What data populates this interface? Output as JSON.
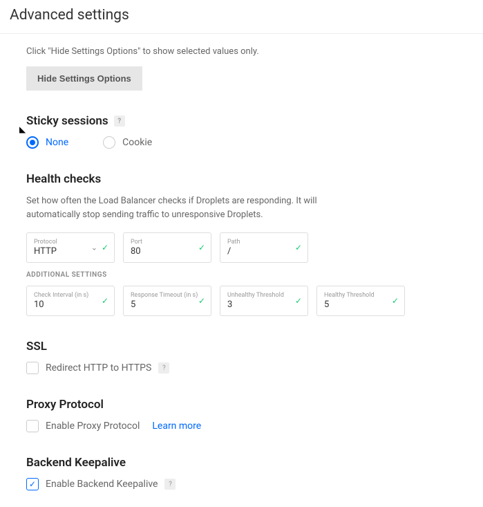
{
  "page_title": "Advanced settings",
  "hint_text": "Click \"Hide Settings Options\" to show selected values only.",
  "hide_button_label": "Hide Settings Options",
  "sticky": {
    "title": "Sticky sessions",
    "options": [
      "None",
      "Cookie"
    ],
    "selected": "None"
  },
  "health": {
    "title": "Health checks",
    "description": "Set how often the Load Balancer checks if Droplets are responding. It will automatically stop sending traffic to unresponsive Droplets.",
    "fields": {
      "protocol": {
        "label": "Protocol",
        "value": "HTTP"
      },
      "port": {
        "label": "Port",
        "value": "80"
      },
      "path": {
        "label": "Path",
        "value": "/"
      }
    },
    "additional_label": "ADDITIONAL SETTINGS",
    "additional": {
      "check_interval": {
        "label": "Check Interval (in s)",
        "value": "10"
      },
      "response_timeout": {
        "label": "Response Timeout (in s)",
        "value": "5"
      },
      "unhealthy_threshold": {
        "label": "Unhealthy Threshold",
        "value": "3"
      },
      "healthy_threshold": {
        "label": "Healthy Threshold",
        "value": "5"
      }
    }
  },
  "ssl": {
    "title": "SSL",
    "checkbox_label": "Redirect HTTP to HTTPS",
    "checked": false
  },
  "proxy": {
    "title": "Proxy Protocol",
    "checkbox_label": "Enable Proxy Protocol",
    "learn_more": "Learn more",
    "checked": false
  },
  "keepalive": {
    "title": "Backend Keepalive",
    "checkbox_label": "Enable Backend Keepalive",
    "checked": true
  }
}
